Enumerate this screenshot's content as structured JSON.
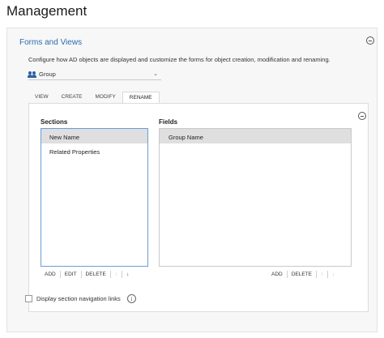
{
  "page": {
    "title": "Management"
  },
  "panel": {
    "title": "Forms and Views",
    "description": "Configure how AD objects are displayed and customize the forms for object creation, modification and renaming.",
    "object_select": {
      "value": "Group"
    }
  },
  "tabs": [
    {
      "label": "VIEW"
    },
    {
      "label": "CREATE"
    },
    {
      "label": "MODIFY"
    },
    {
      "label": "RENAME",
      "active": true
    }
  ],
  "sections": {
    "title": "Sections",
    "items": [
      {
        "label": "New Name",
        "selected": true
      },
      {
        "label": "Related Properties"
      }
    ],
    "buttons": {
      "add": "ADD",
      "edit": "EDIT",
      "delete": "DELETE",
      "up": "↑",
      "down": "↓"
    }
  },
  "fields": {
    "title": "Fields",
    "items": [
      {
        "label": "Group Name",
        "selected": true
      }
    ],
    "buttons": {
      "add": "ADD",
      "delete": "DELETE",
      "up": "↑",
      "down": "↓"
    }
  },
  "options": {
    "display_nav_links": "Display section navigation links",
    "display_nav_links_checked": false
  },
  "icons": {
    "collapse": "collapse-icon",
    "group": "group-icon",
    "info": "info-icon",
    "chevron": "chevron-down-icon"
  },
  "colors": {
    "accent": "#2b6cb0",
    "selection_border": "#6a9dd8"
  }
}
